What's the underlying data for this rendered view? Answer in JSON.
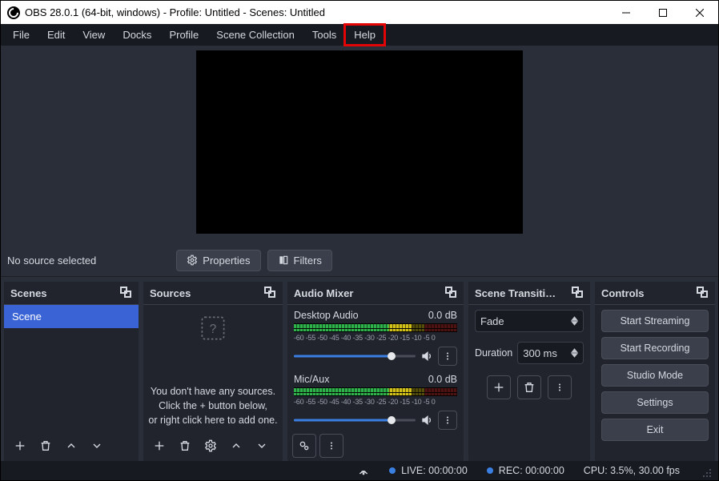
{
  "title": "OBS 28.0.1 (64-bit, windows) - Profile: Untitled - Scenes: Untitled",
  "menu": {
    "file": "File",
    "edit": "Edit",
    "view": "View",
    "docks": "Docks",
    "profile": "Profile",
    "sceneCollection": "Scene Collection",
    "tools": "Tools",
    "help": "Help"
  },
  "toolbar": {
    "noSource": "No source selected",
    "properties": "Properties",
    "filters": "Filters"
  },
  "docks": {
    "scenes": {
      "title": "Scenes",
      "item": "Scene"
    },
    "sources": {
      "title": "Sources",
      "msgLine1": "You don't have any sources.",
      "msgLine2": "Click the + button below,",
      "msgLine3": "or right click here to add one."
    },
    "mixer": {
      "title": "Audio Mixer",
      "ch1": {
        "name": "Desktop Audio",
        "level": "0.0 dB"
      },
      "ch2": {
        "name": "Mic/Aux",
        "level": "0.0 dB"
      },
      "scale": "-60 -55 -50 -45 -40 -35 -30 -25 -20 -15 -10 -5  0"
    },
    "transitions": {
      "title": "Scene Transiti…",
      "type": "Fade",
      "durationLabel": "Duration",
      "durationValue": "300 ms"
    },
    "controls": {
      "title": "Controls",
      "startStreaming": "Start Streaming",
      "startRecording": "Start Recording",
      "studioMode": "Studio Mode",
      "settings": "Settings",
      "exit": "Exit"
    }
  },
  "status": {
    "live": "LIVE: 00:00:00",
    "rec": "REC: 00:00:00",
    "cpu": "CPU: 3.5%, 30.00 fps"
  }
}
